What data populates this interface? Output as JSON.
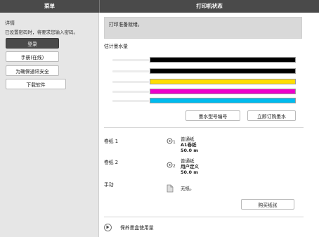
{
  "header": {
    "menu_tab": "菜单",
    "status_tab": "打印机状态"
  },
  "sidebar": {
    "section_title": "详情",
    "section_text": "已设置密码时，将要求您输入密码。",
    "buttons": {
      "login": "登录",
      "manual": "手册(在线)",
      "secure": "为确保通讯安全",
      "download": "下载软件"
    }
  },
  "main": {
    "status_message": "打印准备就绪。",
    "ink_title": "估计墨水量",
    "inks": [
      {
        "name": "matte-black",
        "color": "#000000",
        "level": 1.0
      },
      {
        "name": "black",
        "color": "#000000",
        "level": 1.0
      },
      {
        "name": "yellow",
        "color": "#ffdd00",
        "level": 1.0
      },
      {
        "name": "magenta",
        "color": "#ee00cc",
        "level": 1.0
      },
      {
        "name": "cyan",
        "color": "#00bbee",
        "level": 1.0
      }
    ],
    "ink_model_button": "墨水型号编号",
    "buy_ink_button": "立即订购墨水",
    "paper": [
      {
        "label": "卷纸 1",
        "icon": "roll-1-icon",
        "line1": "普通纸",
        "line2": "A1卷纸",
        "line3": "50.0 m"
      },
      {
        "label": "卷纸 2",
        "icon": "roll-2-icon",
        "line1": "普通纸",
        "line2": "用户定义",
        "line3": "50.0 m"
      }
    ],
    "manual_feed": {
      "label": "手动",
      "icon": "sheet-icon",
      "text": "无纸。"
    },
    "buy_paper_button": "购买纸张",
    "ink_usage_link": "保养墨盒使用量"
  }
}
